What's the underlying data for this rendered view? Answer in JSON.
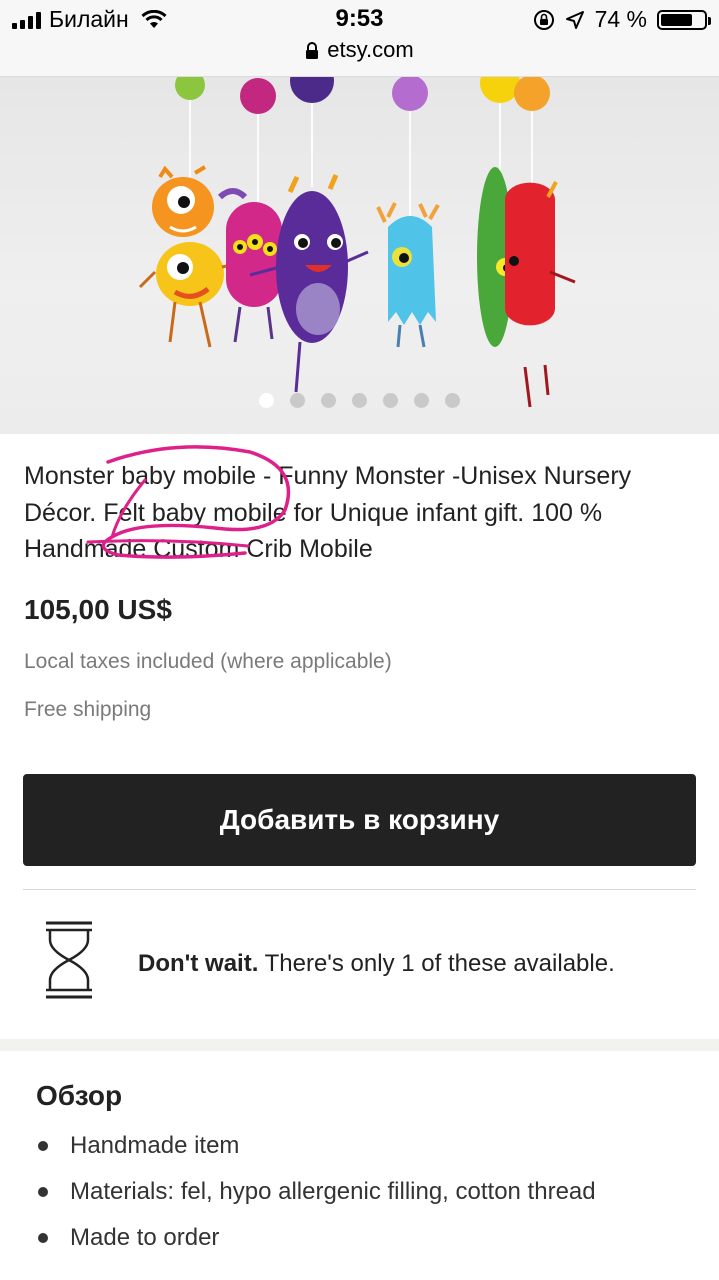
{
  "status_bar": {
    "carrier": "Билайн",
    "time": "9:53",
    "url": "etsy.com",
    "battery": "74 %",
    "battery_level": 0.74
  },
  "gallery": {
    "image_count": 7,
    "active_index": 0
  },
  "listing": {
    "title": "Monster baby mobile - Funny Monster -Unisex Nursery Décor. Felt baby mobile for Unique infant gift. 100 % Handmade Custom Crib Mobile",
    "price": "105,00 US$",
    "taxes_note": "Local taxes included (where applicable)",
    "shipping_note": "Free shipping"
  },
  "cart_button": {
    "label": "Добавить в корзину"
  },
  "scarcity": {
    "bold": "Don't wait.",
    "text": " There's only 1 of these available."
  },
  "overview": {
    "title": "Обзор",
    "items": [
      "Handmade item",
      "Materials: fel, hypo allergenic filling, cotton thread",
      "Made to order"
    ]
  },
  "colors": {
    "button_bg": "#222222",
    "annotation": "#e0208a"
  }
}
